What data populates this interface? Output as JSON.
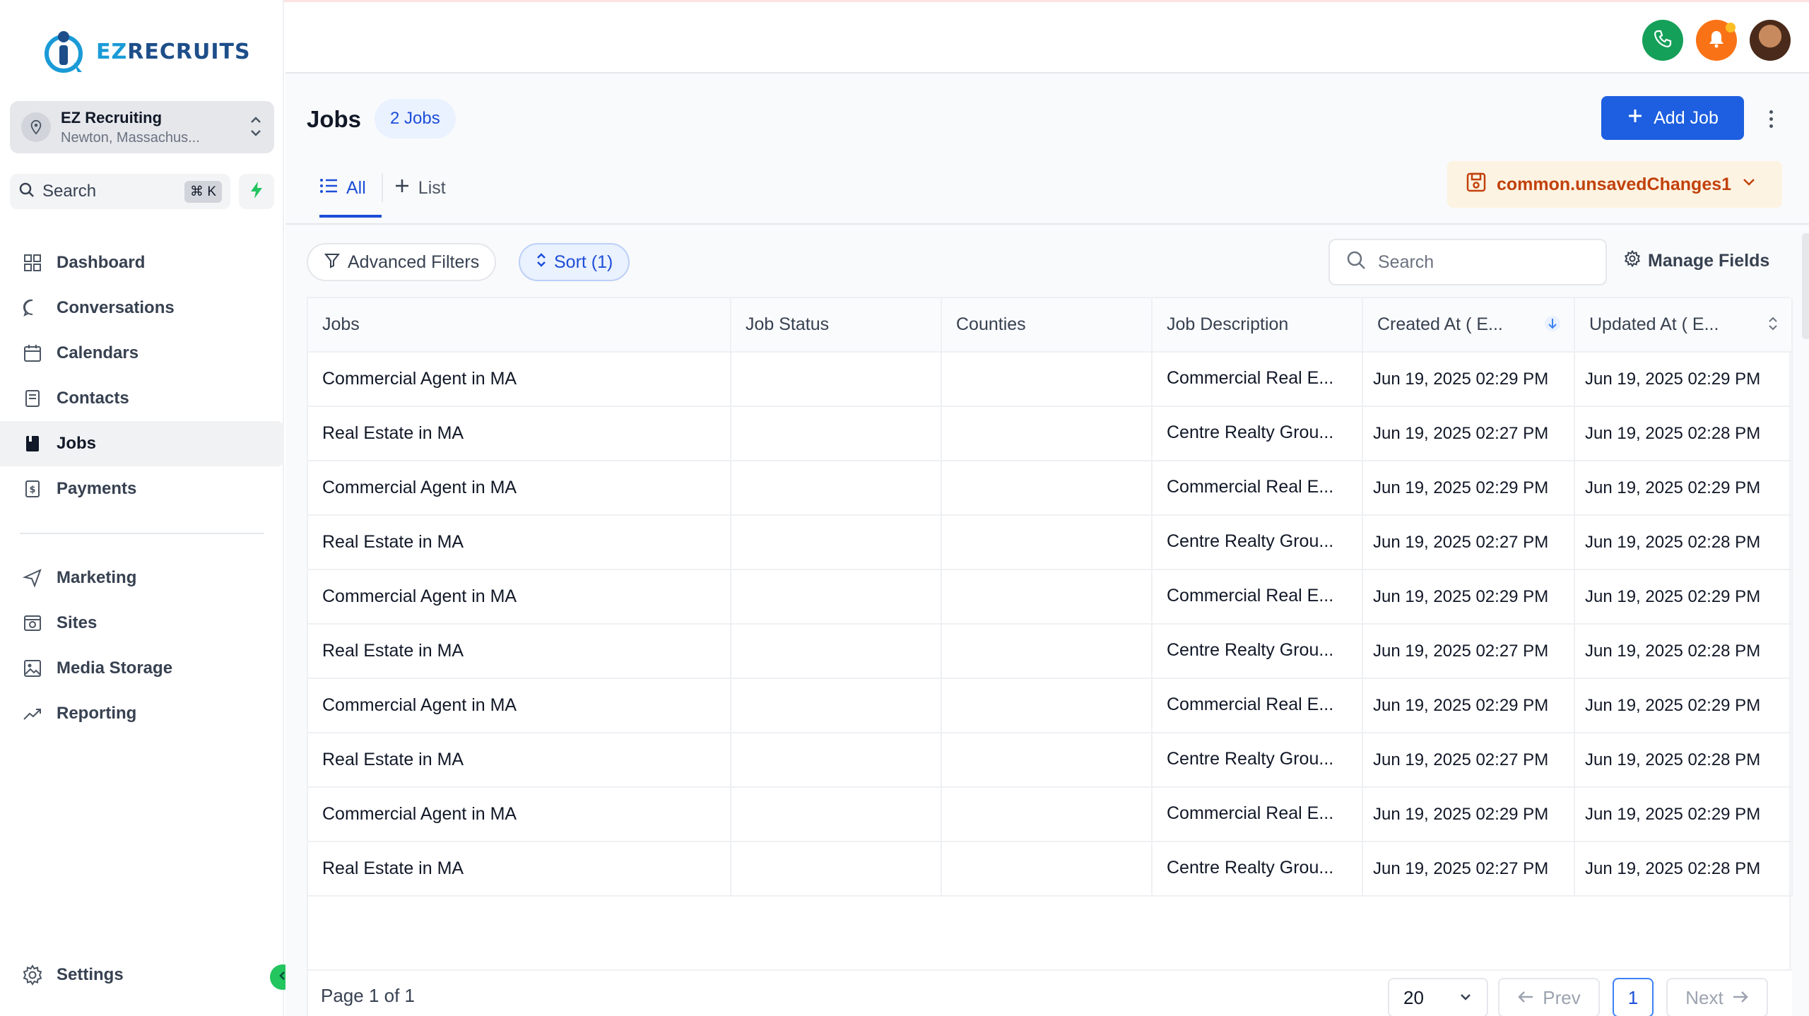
{
  "brand": {
    "logo_text_ez": "EZ",
    "logo_text_rest": "RECRUITS"
  },
  "account": {
    "name": "EZ Recruiting",
    "location": "Newton, Massachus..."
  },
  "sidebar_search": {
    "label": "Search",
    "shortcut": "⌘ K"
  },
  "nav": {
    "items": [
      {
        "label": "Dashboard",
        "icon": "dashboard-icon"
      },
      {
        "label": "Conversations",
        "icon": "chat-icon"
      },
      {
        "label": "Calendars",
        "icon": "calendar-icon"
      },
      {
        "label": "Contacts",
        "icon": "contacts-icon"
      },
      {
        "label": "Jobs",
        "icon": "jobs-icon",
        "active": true
      },
      {
        "label": "Payments",
        "icon": "payments-icon"
      }
    ],
    "items2": [
      {
        "label": "Marketing",
        "icon": "send-icon"
      },
      {
        "label": "Sites",
        "icon": "sites-icon"
      },
      {
        "label": "Media Storage",
        "icon": "image-icon"
      },
      {
        "label": "Reporting",
        "icon": "trend-icon"
      }
    ],
    "settings": "Settings"
  },
  "page": {
    "title": "Jobs",
    "count": "2 Jobs",
    "add_button": "Add Job",
    "tabs": [
      {
        "label": "All"
      },
      {
        "label": "List"
      }
    ],
    "unsaved": "common.unsavedChanges1",
    "advanced_filters": "Advanced Filters",
    "sort": "Sort (1)",
    "search_placeholder": "Search",
    "manage_fields": "Manage Fields"
  },
  "table": {
    "columns": [
      "Jobs",
      "Job Status",
      "Counties",
      "Job Description",
      "Created At ( E...",
      "Updated At ( E..."
    ],
    "rows": [
      [
        "Commercial Agent in MA",
        "",
        "",
        "Commercial Real E...",
        "Jun 19, 2025 02:29 PM",
        "Jun 19, 2025 02:29 PM"
      ],
      [
        "Real Estate in MA",
        "",
        "",
        "Centre Realty Grou...",
        "Jun 19, 2025 02:27 PM",
        "Jun 19, 2025 02:28 PM"
      ],
      [
        "Commercial Agent in MA",
        "",
        "",
        "Commercial Real E...",
        "Jun 19, 2025 02:29 PM",
        "Jun 19, 2025 02:29 PM"
      ],
      [
        "Real Estate in MA",
        "",
        "",
        "Centre Realty Grou...",
        "Jun 19, 2025 02:27 PM",
        "Jun 19, 2025 02:28 PM"
      ],
      [
        "Commercial Agent in MA",
        "",
        "",
        "Commercial Real E...",
        "Jun 19, 2025 02:29 PM",
        "Jun 19, 2025 02:29 PM"
      ],
      [
        "Real Estate in MA",
        "",
        "",
        "Centre Realty Grou...",
        "Jun 19, 2025 02:27 PM",
        "Jun 19, 2025 02:28 PM"
      ],
      [
        "Commercial Agent in MA",
        "",
        "",
        "Commercial Real E...",
        "Jun 19, 2025 02:29 PM",
        "Jun 19, 2025 02:29 PM"
      ],
      [
        "Real Estate in MA",
        "",
        "",
        "Centre Realty Grou...",
        "Jun 19, 2025 02:27 PM",
        "Jun 19, 2025 02:28 PM"
      ],
      [
        "Commercial Agent in MA",
        "",
        "",
        "Commercial Real E...",
        "Jun 19, 2025 02:29 PM",
        "Jun 19, 2025 02:29 PM"
      ],
      [
        "Real Estate in MA",
        "",
        "",
        "Centre Realty Grou...",
        "Jun 19, 2025 02:27 PM",
        "Jun 19, 2025 02:28 PM"
      ]
    ]
  },
  "pagination": {
    "page_info": "Page 1 of 1",
    "per_page": "20",
    "prev": "Prev",
    "current": "1",
    "next": "Next"
  },
  "colors": {
    "primary": "#1d5fe0",
    "phone": "#15a05a",
    "bell": "#f97316",
    "unsaved_text": "#c2410c"
  }
}
